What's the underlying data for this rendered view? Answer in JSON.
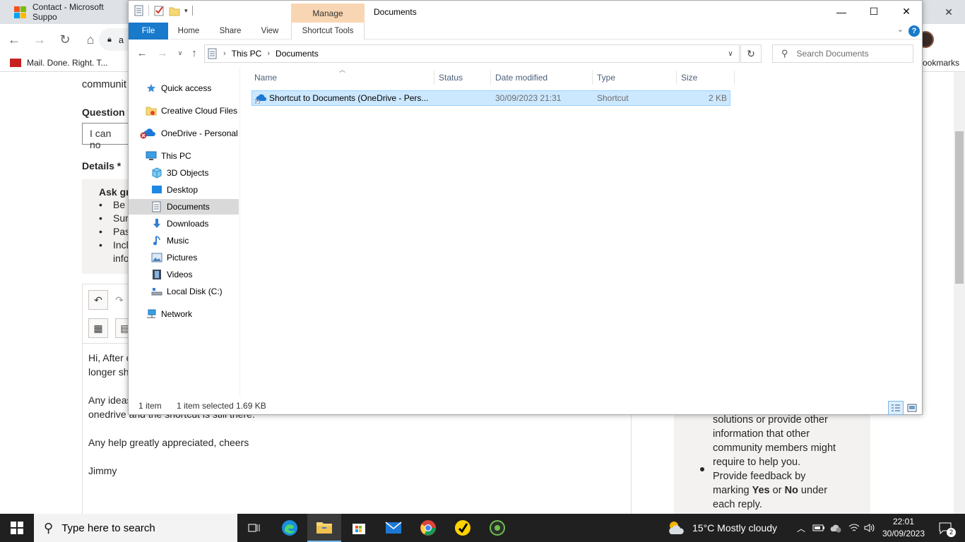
{
  "chrome": {
    "tab_title": "Contact - Microsoft Suppo",
    "omnibox_text": "a",
    "bookmarks": [
      {
        "label": "Mail. Done. Right. T..."
      },
      {
        "label": "ookmarks"
      }
    ]
  },
  "web": {
    "top_text": "communit",
    "question_label": "Question *",
    "question_value": "I can no",
    "details_label": "Details *",
    "guide_title": "Ask gr",
    "guide_items": [
      "Be c",
      "Sum",
      "Pas",
      "Incl",
      "info"
    ],
    "editor_lines": [
      "Hi, After c",
      "longer sh",
      "Any ideas",
      "onedrive and the shortcut is still there.",
      "Any help greatly appreciated, cheers",
      "Jimmy"
    ],
    "right_lines": [
      "solutions or provide other",
      "information that other",
      "community members might",
      "require to help you.",
      "Provide feedback by",
      "each reply."
    ],
    "right_marking_prefix": "marking ",
    "right_marking_yes": "Yes",
    "right_marking_or": " or ",
    "right_marking_no": "No",
    "right_marking_suffix": " under"
  },
  "explorer": {
    "title": "Documents",
    "manage_label": "Manage",
    "ribbon_tabs": {
      "file": "File",
      "home": "Home",
      "share": "Share",
      "view": "View",
      "shortcut_tools": "Shortcut Tools"
    },
    "breadcrumb": [
      "This PC",
      "Documents"
    ],
    "search_placeholder": "Search Documents",
    "nav": {
      "quick_access": "Quick access",
      "creative_cloud": "Creative Cloud Files",
      "onedrive": "OneDrive - Personal",
      "this_pc": "This PC",
      "objects3d": "3D Objects",
      "desktop": "Desktop",
      "documents": "Documents",
      "downloads": "Downloads",
      "music": "Music",
      "pictures": "Pictures",
      "videos": "Videos",
      "local_disk": "Local Disk (C:)",
      "network": "Network"
    },
    "columns": {
      "name": "Name",
      "status": "Status",
      "date_modified": "Date modified",
      "type": "Type",
      "size": "Size"
    },
    "files": [
      {
        "name": "Shortcut to Documents (OneDrive - Pers...",
        "status": "",
        "date_modified": "30/09/2023 21:31",
        "type": "Shortcut",
        "size": "2 KB"
      }
    ],
    "status": {
      "count": "1 item",
      "selected": "1 item selected  1.69 KB"
    }
  },
  "taskbar": {
    "search_placeholder": "Type here to search",
    "weather": "15°C  Mostly cloudy",
    "time": "22:01",
    "date": "30/09/2023",
    "notifications": "2"
  },
  "colors": {
    "accent": "#1979ca",
    "selection": "#cce8ff",
    "manage": "#f9d6b3",
    "taskbar": "#202020"
  }
}
